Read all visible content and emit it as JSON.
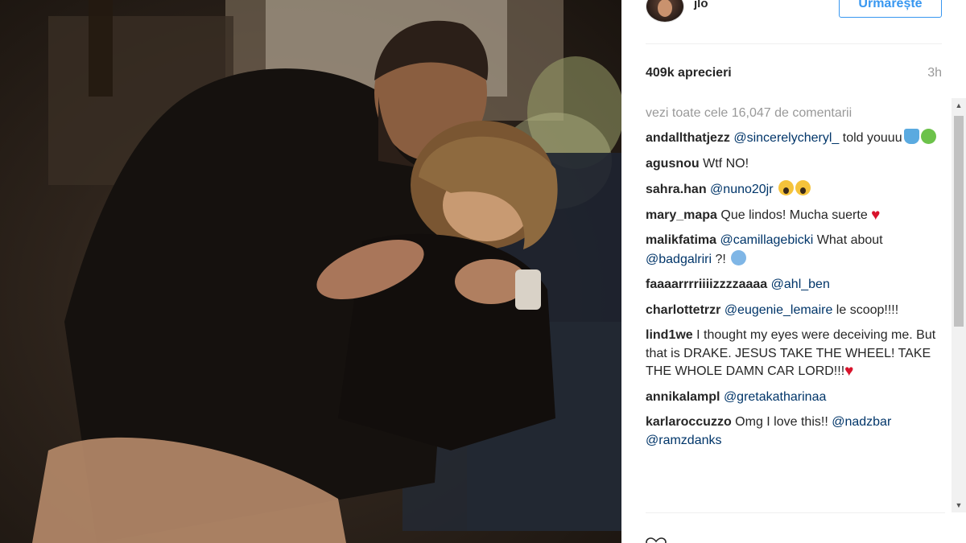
{
  "post": {
    "username": "jlo",
    "follow_label": "Urmărește",
    "likes": "409k aprecieri",
    "time": "3h",
    "view_all_comments": "vezi toate cele 16,047 de comentarii"
  },
  "comments": [
    {
      "user": "andallthatjezz",
      "parts": [
        {
          "t": "mention",
          "v": "@sincerelycheryl_"
        },
        {
          "t": "text",
          "v": " told youuu"
        }
      ],
      "emoji": [
        "cup",
        "frog"
      ]
    },
    {
      "user": "agusnou",
      "parts": [
        {
          "t": "text",
          "v": "Wtf NO!"
        }
      ],
      "emoji": []
    },
    {
      "user": "sahra.han",
      "parts": [
        {
          "t": "mention",
          "v": "@nuno20jr"
        },
        {
          "t": "text",
          "v": " "
        }
      ],
      "emoji": [
        "scream",
        "scream"
      ]
    },
    {
      "user": "mary_mapa",
      "parts": [
        {
          "t": "text",
          "v": "Que lindos! Mucha suerte "
        }
      ],
      "emoji": [
        "heart"
      ]
    },
    {
      "user": "malikfatima",
      "parts": [
        {
          "t": "mention",
          "v": "@camillagebicki"
        },
        {
          "t": "text",
          "v": " What about "
        },
        {
          "t": "mention",
          "v": "@badgalriri"
        },
        {
          "t": "text",
          "v": " ?! "
        }
      ],
      "emoji": [
        "cold"
      ]
    },
    {
      "user": "faaaarrrriiiizzzzaaaa",
      "parts": [
        {
          "t": "mention",
          "v": "@ahl_ben"
        }
      ],
      "emoji": []
    },
    {
      "user": "charlottetrzr",
      "parts": [
        {
          "t": "mention",
          "v": "@eugenie_lemaire"
        },
        {
          "t": "text",
          "v": " le scoop!!!!"
        }
      ],
      "emoji": []
    },
    {
      "user": "lind1we",
      "parts": [
        {
          "t": "text",
          "v": "I thought my eyes were deceiving me. But that is DRAKE. JESUS TAKE THE WHEEL! TAKE THE WHOLE DAMN CAR LORD!!!"
        }
      ],
      "emoji": [
        "heart"
      ]
    },
    {
      "user": "annikalampl",
      "parts": [
        {
          "t": "mention",
          "v": "@gretakatharinaa"
        }
      ],
      "emoji": []
    },
    {
      "user": "karlaroccuzzo",
      "parts": [
        {
          "t": "text",
          "v": "Omg I love this!! "
        },
        {
          "t": "mention",
          "v": "@nadzbar"
        },
        {
          "t": "text",
          "v": " "
        },
        {
          "t": "mention",
          "v": "@ramzdanks"
        }
      ],
      "emoji": []
    }
  ],
  "icons": {
    "like": "heart-outline-icon",
    "scroll_up": "scroll-up-arrow-icon",
    "scroll_down": "scroll-down-arrow-icon"
  },
  "colors": {
    "accent": "#3897f0",
    "mention": "#003569",
    "muted": "#999999",
    "heart": "#d8132b"
  }
}
